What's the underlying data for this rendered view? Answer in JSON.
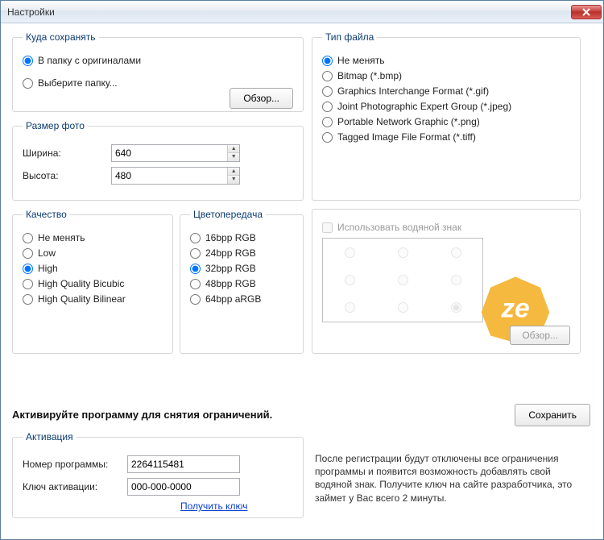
{
  "window": {
    "title": "Настройки"
  },
  "save_to": {
    "legend": "Куда сохранять",
    "opt_originals": "В папку с оригиналами",
    "opt_choose": "Выберите папку...",
    "browse": "Обзор...",
    "selected": "originals"
  },
  "size": {
    "legend": "Размер фото",
    "width_label": "Ширина:",
    "height_label": "Высота:",
    "width": "640",
    "height": "480"
  },
  "quality": {
    "legend": "Качество",
    "options": [
      "Не менять",
      "Low",
      "High",
      "High Quality Bicubic",
      "High Quality Bilinear"
    ],
    "selected": "High"
  },
  "color": {
    "legend": "Цветопередача",
    "options": [
      "16bpp RGB",
      "24bpp RGB",
      "32bpp RGB",
      "48bpp RGB",
      "64bpp aRGB"
    ],
    "selected": "32bpp RGB"
  },
  "filetype": {
    "legend": "Тип файла",
    "options": [
      "Не менять",
      "Bitmap (*.bmp)",
      "Graphics Interchange Format (*.gif)",
      "Joint Photographic Expert Group (*.jpeg)",
      "Portable Network Graphic (*.png)",
      "Tagged Image File Format (*.tiff)"
    ],
    "selected": "Не менять"
  },
  "watermark": {
    "use_label": "Использовать водяной знак",
    "enabled": false,
    "position_index": 8,
    "browse": "Обзор..."
  },
  "activate_banner": "Активируйте программу для снятия ограничений.",
  "buttons": {
    "save": "Сохранить"
  },
  "activation": {
    "legend": "Активация",
    "id_label": "Номер программы:",
    "id_value": "2264115481",
    "key_label": "Ключ активации:",
    "key_value": "000-000-0000",
    "get_key": "Получить ключ"
  },
  "reg_info": "После регистрации будут отключены все ограничения программы и появится возможность добавлять свой водяной знак. Получите ключ на сайте разработчика, это займет у Вас всего 2 минуты."
}
